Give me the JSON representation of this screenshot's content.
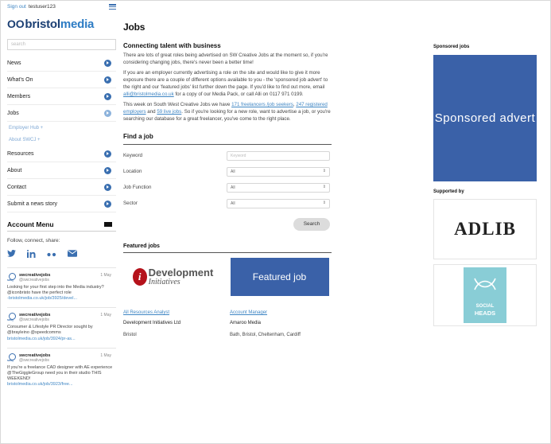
{
  "topbar": {
    "signout": "Sign out",
    "username": "testuser123"
  },
  "logo": {
    "mark": "OO",
    "part1": "bristol",
    "part2": "media"
  },
  "search": {
    "placeholder": "search"
  },
  "nav": {
    "items": [
      {
        "label": "News"
      },
      {
        "label": "What's On"
      },
      {
        "label": "Members"
      },
      {
        "label": "Jobs"
      }
    ],
    "sub": [
      {
        "label": "Employer Hub +"
      },
      {
        "label": "About SWCJ +"
      }
    ],
    "items2": [
      {
        "label": "Resources"
      },
      {
        "label": "About"
      },
      {
        "label": "Contact"
      },
      {
        "label": "Submit a news story"
      }
    ]
  },
  "account": {
    "title": "Account Menu",
    "follow": "Follow, connect, share:",
    "social": [
      "twitter-icon",
      "linkedin-icon",
      "flickr-icon",
      "email-icon"
    ]
  },
  "tweets": [
    {
      "name": "swcreativejobs",
      "handle": "@swcreativejobs",
      "date": "1 May",
      "text": "Looking for your first step into the Media industry? @iconbristo have the perfect role",
      "link": "-bristolmedia.co.uk/job/3925/devel..."
    },
    {
      "name": "swcreativejobs",
      "handle": "@swcreativejobs",
      "date": "1 May",
      "text": "Consumer & Lifestyle PR Director sought by @brayleino @speedcomms",
      "link": "bristolmedia.co.uk/job/3924/pr-as..."
    },
    {
      "name": "swcreativejobs",
      "handle": "@swcreativejobs",
      "date": "1 May",
      "text": "If you're a freelance CAD designer with AE experience @TheGiggleGroup need you in their studio THIS WEEKEND!",
      "link": "bristolmedia.co.uk/job/3923/free..."
    }
  ],
  "main": {
    "title": "Jobs",
    "subhead": "Connecting talent with business",
    "p1": "There are lots of great roles being advertised on SW Creative Jobs at the moment so, if you're considering changing jobs, there's never been a better time!",
    "p2a": "If you are an employer currently advertising a role on the site and would like to give it more exposure there are a couple of different options available to you - the 'sponsored job advert' to the right and our 'featured jobs' list further down the page. If you'd like to find out more, email ",
    "p2link": "alli@bristolmedia.co.uk",
    "p2b": " for a copy of our Media Pack, or call Alli on 0117 971 0199.",
    "p3a": "This week on South West Creative Jobs we have ",
    "p3link1": "171 freelancers /job seekers",
    "p3mid": ", ",
    "p3link2": "247 registered employers",
    "p3and": " and ",
    "p3link3": "59 live jobs",
    "p3b": ". So if you're looking for a new role, want to advertise a job, or you're searching our database for a great freelancer, you've come to the right place."
  },
  "findjob": {
    "title": "Find a job",
    "rows": [
      {
        "label": "Keyword",
        "value": "Keyword"
      },
      {
        "label": "Location",
        "value": "All"
      },
      {
        "label": "Job Function",
        "value": "All"
      },
      {
        "label": "Sector",
        "value": "All"
      }
    ],
    "search_label": "Search"
  },
  "featured": {
    "title": "Featured jobs",
    "cards": [
      {
        "logo_t1": "Development",
        "logo_t2": "Initiatives",
        "link": "All Resources Analyst",
        "company": "Development Initiatives Ltd",
        "location": "Bristol"
      },
      {
        "box_label": "Featured job",
        "link": "Account Manager",
        "company": "Amaroo Media",
        "location": "Bath, Bristol, Cheltenham, Cardiff"
      }
    ]
  },
  "right": {
    "sponsored_title": "Sponsored jobs",
    "sponsored_box": "Sponsored advert",
    "supported_title": "Supported by",
    "adlib": "ADLIB",
    "social_heads_1": "SOCIAL",
    "social_heads_2": "HEADS"
  },
  "colors": {
    "accent": "#3a61a8",
    "link": "#3f86c4",
    "brand_dark": "#1b3f73"
  }
}
